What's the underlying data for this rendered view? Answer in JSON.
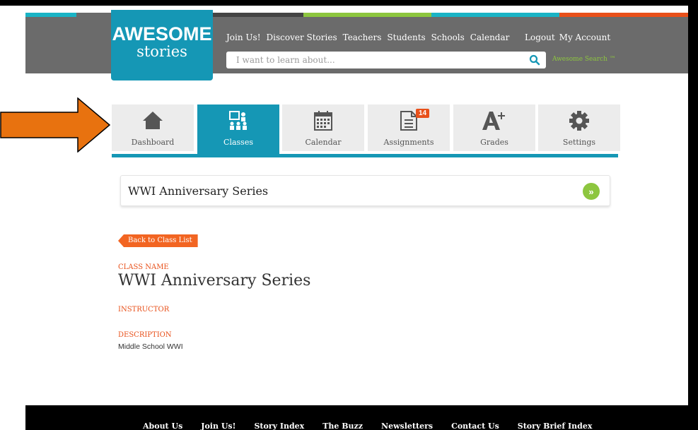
{
  "colors": {
    "brand_blue": "#1597b5",
    "header_gray": "#6b6b6b",
    "accent_orange": "#f26522",
    "accent_green": "#8dc63f",
    "stripe_colors": [
      "#1ab3c5",
      "#6b6b6b",
      "#444444",
      "#8dc63f",
      "#1ab3c5",
      "#e8501a"
    ]
  },
  "logo": {
    "line1": "AWESOME",
    "line2": "stories"
  },
  "topnav": {
    "items": [
      "Join Us!",
      "Discover Stories",
      "Teachers",
      "Students",
      "Schools",
      "Calendar"
    ],
    "account": [
      "Logout",
      "My Account"
    ]
  },
  "search": {
    "placeholder": "I want to learn about...",
    "icon": "search-icon",
    "awesome_search": "Awesome Search ™"
  },
  "tabs": [
    {
      "label": "Dashboard",
      "icon": "home-icon",
      "active": false
    },
    {
      "label": "Classes",
      "icon": "classroom-icon",
      "active": true
    },
    {
      "label": "Calendar",
      "icon": "calendar-icon",
      "active": false
    },
    {
      "label": "Assignments",
      "icon": "document-icon",
      "active": false,
      "badge": "14"
    },
    {
      "label": "Grades",
      "icon": "grade-a-plus-icon",
      "active": false
    },
    {
      "label": "Settings",
      "icon": "gear-icon",
      "active": false
    }
  ],
  "class_bar": {
    "title": "WWI Anniversary Series",
    "go_icon": "double-chevron-right-icon",
    "go_glyph": "»"
  },
  "back_button": "Back to Class List",
  "details": {
    "class_name_label": "CLASS NAME",
    "class_name": "WWI Anniversary Series",
    "instructor_label": "INSTRUCTOR",
    "description_label": "DESCRIPTION",
    "description": "Middle School WWI"
  },
  "footer": {
    "items": [
      "About Us",
      "Join Us!",
      "Story Index",
      "The Buzz",
      "Newsletters",
      "Contact Us",
      "Story Brief Index"
    ]
  }
}
